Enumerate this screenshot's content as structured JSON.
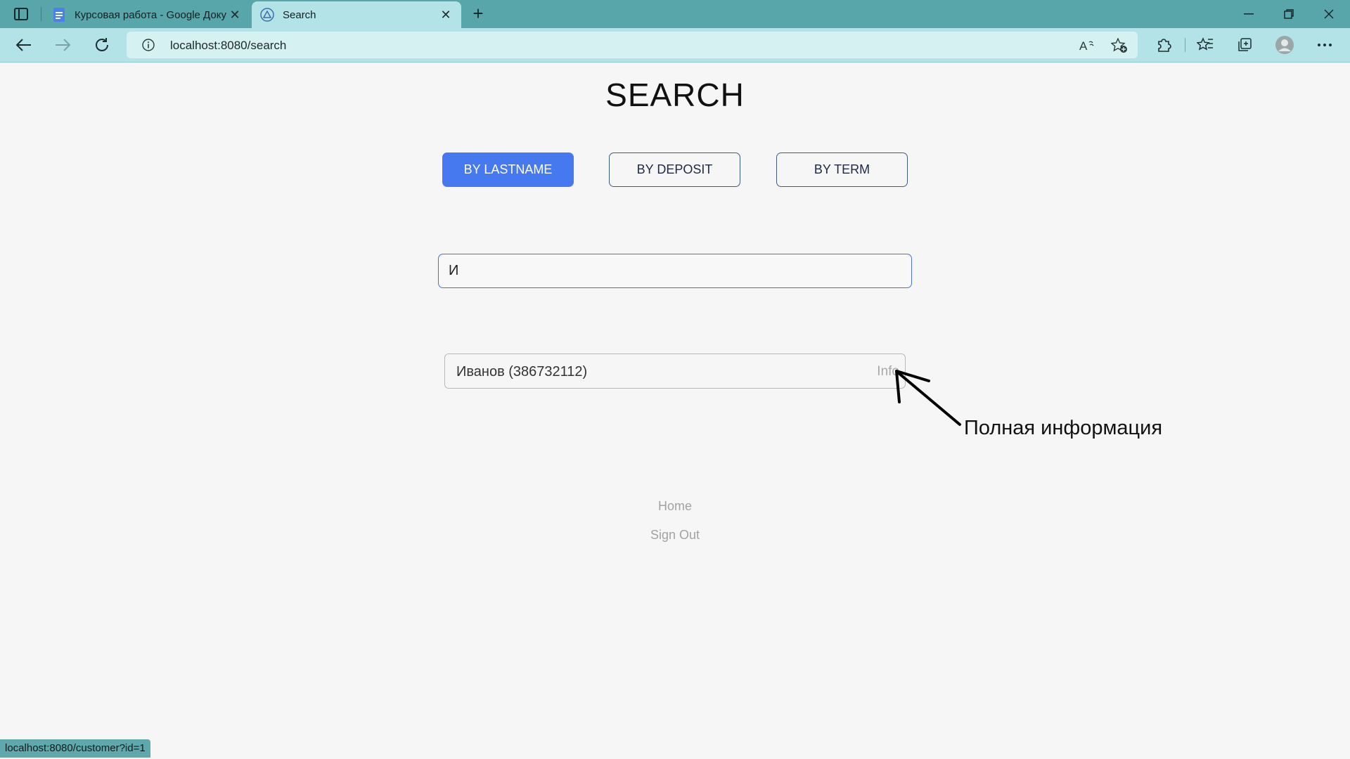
{
  "browser": {
    "tabs": [
      {
        "title": "Курсовая работа - Google Доку",
        "icon": "google-docs-icon",
        "active": false
      },
      {
        "title": "Search",
        "icon": "site-favicon",
        "active": true
      }
    ],
    "url": "localhost:8080/search",
    "status_url": "localhost:8080/customer?id=1",
    "colors": {
      "tabbar": "#58a6aa",
      "toolbar": "#b3e3e6"
    }
  },
  "page": {
    "title": "SEARCH",
    "modes": [
      "BY LASTNAME",
      "BY DEPOSIT",
      "BY TERM"
    ],
    "active_mode": "BY LASTNAME",
    "search_value": "И",
    "results": [
      {
        "label": "Иванов (386732112)",
        "action": "Info"
      }
    ],
    "footer": {
      "home": "Home",
      "sign_out": "Sign Out"
    },
    "colors": {
      "accent": "#4678f0"
    }
  },
  "annotation": {
    "text": "Полная информация"
  }
}
